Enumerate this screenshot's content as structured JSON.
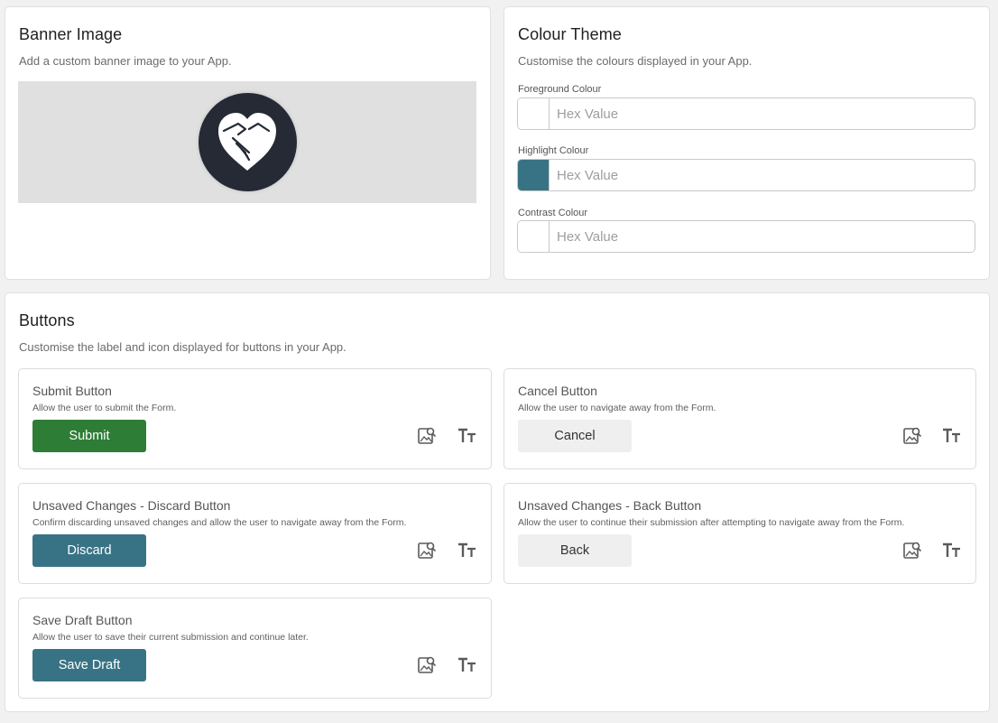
{
  "banner": {
    "title": "Banner Image",
    "description": "Add a custom banner image to your App.",
    "background_color": "#e0e0e0",
    "logo_color": "#252a35"
  },
  "colour_theme": {
    "title": "Colour Theme",
    "description": "Customise the colours displayed in your App.",
    "fields": [
      {
        "label": "Foreground Colour",
        "placeholder": "Hex Value",
        "value": "",
        "swatch": "#ffffff"
      },
      {
        "label": "Highlight Colour",
        "placeholder": "Hex Value",
        "value": "",
        "swatch": "#387385"
      },
      {
        "label": "Contrast Colour",
        "placeholder": "Hex Value",
        "value": "",
        "swatch": "#ffffff"
      }
    ]
  },
  "buttons_section": {
    "title": "Buttons",
    "description": "Customise the label and icon displayed for buttons in your App.",
    "items": [
      {
        "title": "Submit Button",
        "description": "Allow the user to submit the Form.",
        "label": "Submit",
        "color": "#2e7d37"
      },
      {
        "title": "Cancel Button",
        "description": "Allow the user to navigate away from the Form.",
        "label": "Cancel",
        "color": "#efefef"
      },
      {
        "title": "Unsaved Changes - Discard Button",
        "description": "Confirm discarding unsaved changes and allow the user to navigate away from the Form.",
        "label": "Discard",
        "color": "#387385"
      },
      {
        "title": "Unsaved Changes - Back Button",
        "description": "Allow the user to continue their submission after attempting to navigate away from the Form.",
        "label": "Back",
        "color": "#efefef"
      },
      {
        "title": "Save Draft Button",
        "description": "Allow the user to save their current submission and continue later.",
        "label": "Save Draft",
        "color": "#387385"
      }
    ],
    "icons": {
      "image": "image-search-icon",
      "text": "text-size-icon"
    }
  }
}
